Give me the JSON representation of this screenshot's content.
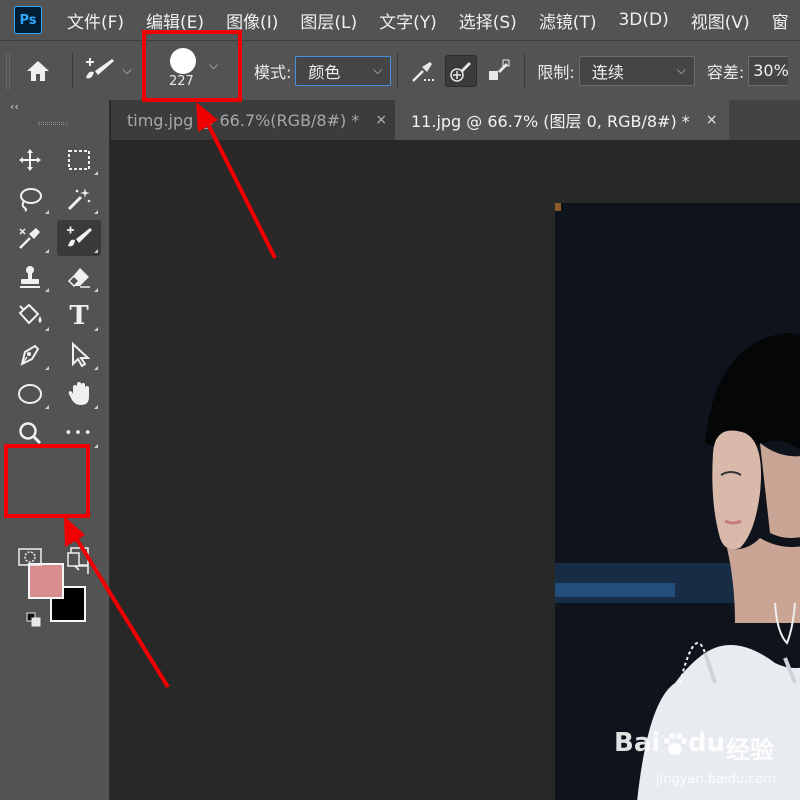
{
  "app": {
    "logo": "Ps"
  },
  "menu": [
    "文件(F)",
    "编辑(E)",
    "图像(I)",
    "图层(L)",
    "文字(Y)",
    "选择(S)",
    "滤镜(T)",
    "3D(D)",
    "视图(V)",
    "窗"
  ],
  "options": {
    "brush_size": "227",
    "mode_label": "模式:",
    "mode_value": "颜色",
    "limit_label": "限制:",
    "limit_value": "连续",
    "tolerance_label": "容差:",
    "tolerance_value": "30%"
  },
  "tabs": [
    {
      "title": "timg.jpg @ 66.7%(RGB/8#) *",
      "close": "×",
      "active": false
    },
    {
      "title": "11.jpg @ 66.7% (图层 0, RGB/8#) *",
      "close": "×",
      "active": true
    }
  ],
  "toolbar": {
    "collapse": "‹‹",
    "tools": [
      "move-icon",
      "marquee-icon",
      "lasso-icon",
      "magic-wand-icon",
      "eyedropper-icon",
      "color-replacement-icon",
      "stamp-icon",
      "eraser-icon",
      "paint-bucket-icon",
      "type-icon",
      "pen-icon",
      "path-select-icon",
      "ellipse-icon",
      "hand-icon",
      "zoom-icon",
      "more-icon"
    ],
    "type_glyph": "T",
    "more_glyph": "•••",
    "foreground_color": "#d88e8e",
    "background_color": "#000000"
  },
  "colors": {
    "annotation": "#f00000",
    "accent": "#31a8ff"
  },
  "watermark": {
    "brand_a": "Bai",
    "brand_b": "du",
    "brand_c": "经验",
    "url": "jingyan.baidu.com"
  }
}
